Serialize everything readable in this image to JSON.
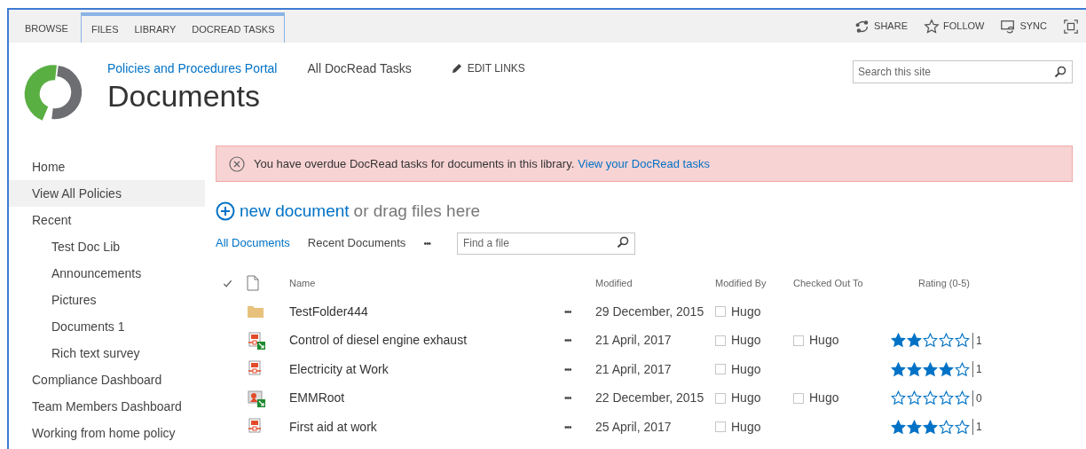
{
  "ribbon": {
    "tabs": [
      {
        "label": "BROWSE"
      }
    ],
    "tool_tabs": [
      {
        "label": "FILES"
      },
      {
        "label": "LIBRARY"
      },
      {
        "label": "DOCREAD TASKS"
      }
    ],
    "actions": [
      {
        "kind": "share",
        "label": "SHARE"
      },
      {
        "kind": "follow",
        "label": "FOLLOW"
      },
      {
        "kind": "sync",
        "label": "SYNC"
      },
      {
        "kind": "focus"
      }
    ]
  },
  "header": {
    "site_link": "Policies and Procedures Portal",
    "links": [
      "All DocRead Tasks"
    ],
    "edit_links": "EDIT LINKS",
    "title": "Documents",
    "search": {
      "placeholder": "Search this site"
    }
  },
  "sidebar": {
    "items": [
      {
        "label": "Home",
        "selected": false
      },
      {
        "label": "View All Policies",
        "selected": true
      },
      {
        "label": "Recent",
        "selected": false,
        "children": [
          {
            "label": "Test Doc Lib",
            "selected": false
          },
          {
            "label": "Announcements",
            "selected": false
          },
          {
            "label": "Pictures",
            "selected": false
          },
          {
            "label": "Documents 1",
            "selected": false
          },
          {
            "label": "Rich text survey",
            "selected": false
          }
        ]
      },
      {
        "label": "Compliance Dashboard",
        "selected": false
      },
      {
        "label": "Team Members Dashboard",
        "selected": false
      },
      {
        "label": "Working from home policy",
        "selected": false
      }
    ]
  },
  "alert": {
    "message": "You have overdue DocRead tasks for documents in this library.",
    "link": "View your DocRead tasks"
  },
  "new_document": {
    "link": "new document",
    "rest": "or drag files here"
  },
  "views": [
    {
      "label": "All Documents",
      "selected": true
    },
    {
      "label": "Recent Documents",
      "selected": false
    }
  ],
  "views_more": "•••",
  "find": {
    "placeholder": "Find a file"
  },
  "table": {
    "columns": {
      "name": "Name",
      "modified": "Modified",
      "modified_by": "Modified By",
      "checked_out_to": "Checked Out To",
      "rating": "Rating (0-5)"
    },
    "rows": [
      {
        "kind": "folder",
        "synced": false,
        "name": "TestFolder444",
        "more": "•••",
        "modified": "29 December, 2015",
        "modified_by": "Hugo"
      },
      {
        "kind": "pdf",
        "synced": true,
        "name": "Control of diesel engine exhaust",
        "more": "•••",
        "modified": "21 April, 2017",
        "modified_by": "Hugo",
        "checked_out_to": "Hugo",
        "stars": 2,
        "rating_count": "1"
      },
      {
        "kind": "pdf",
        "synced": false,
        "name": "Electricity at Work",
        "more": "•••",
        "modified": "21 April, 2017",
        "modified_by": "Hugo",
        "stars": 4,
        "rating_count": "1"
      },
      {
        "kind": "image",
        "synced": true,
        "name": "EMMRoot",
        "more": "•••",
        "modified": "22 December, 2015",
        "modified_by": "Hugo",
        "checked_out_to": "Hugo",
        "stars": 0,
        "rating_count": "0"
      },
      {
        "kind": "pdf",
        "synced": false,
        "name": "First aid at work",
        "more": "•••",
        "modified": "25 April, 2017",
        "modified_by": "Hugo",
        "stars": 3,
        "rating_count": "1"
      }
    ]
  }
}
